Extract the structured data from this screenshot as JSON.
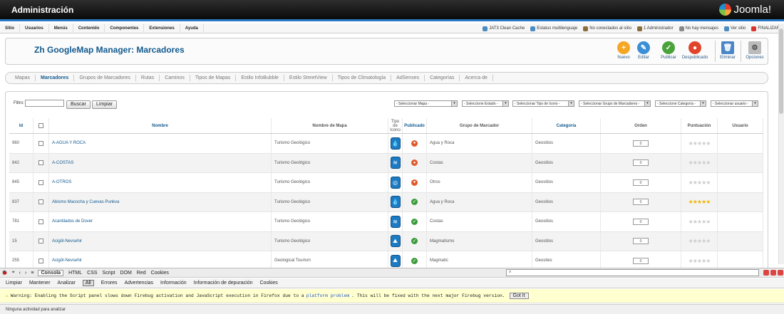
{
  "header": {
    "site_title": "Administración",
    "logo_text": "Joomla!"
  },
  "menu": [
    "Sitio",
    "Usuarios",
    "Menús",
    "Contenido",
    "Componentes",
    "Extensiones",
    "Ayuda"
  ],
  "status": [
    {
      "label": "JAT3 Clean Cache",
      "color": "#4a8bc2"
    },
    {
      "label": "Estatus multilenguaje",
      "color": "#4a8bc2"
    },
    {
      "label": "No conectados al sitio",
      "color": "#8a6d3b"
    },
    {
      "label": "1 Administrador",
      "color": "#8a6d3b"
    },
    {
      "label": "No hay mensajes",
      "color": "#888888"
    },
    {
      "label": "Ver sitio",
      "color": "#4a8bc2"
    },
    {
      "label": "FINALIZAR",
      "color": "#d9342b"
    }
  ],
  "page": {
    "title": "Zh GoogleMap Manager: Marcadores"
  },
  "toolbar": {
    "new": "Nuevo",
    "edit": "Editar",
    "publish": "Publicar",
    "unpublish": "Despublicado",
    "delete": "Eliminar",
    "options": "Opciones"
  },
  "tabs": [
    "Mapas",
    "Marcadores",
    "Grupos de Marcadores",
    "Rutas",
    "Caminos",
    "Tipos de Mapas",
    "Estilo InfoBubble",
    "Estilo StreetView",
    "Tipos de Climatología",
    "AdSenses",
    "Categorías",
    "Acerca de"
  ],
  "active_tab": "Marcadores",
  "filter": {
    "label": "Filtro:",
    "value": "",
    "search_button": "Buscar",
    "clear_button": "Limpiar"
  },
  "selects": [
    "- Seleccionar Mapa -",
    "- Seleccione Estado -",
    "- Seleccionar Tipo de Icono -",
    "- Seleccionar Grupo de Marcadores -",
    "- Seleccione Categoría -",
    "- Seleccionar usuario -"
  ],
  "columns": {
    "id": "Id",
    "name": "Nombre",
    "map_name": "Nombre de Mapa",
    "icon_type": "Tipo de Icono",
    "published": "Publicado",
    "group": "Grupo de Marcador",
    "category": "Categoría",
    "order": "Orden",
    "rating": "Puntuación",
    "user": "Usuario"
  },
  "rows": [
    {
      "id": "960",
      "name": "A-AGUA Y ROCA",
      "map": "Turismo Geológico",
      "icon": "drop",
      "published": false,
      "group": "Agua y Roca",
      "category": "Geositios",
      "order": "0",
      "rating": 0
    },
    {
      "id": "842",
      "name": "A-COSTAS",
      "map": "Turismo Geológico",
      "icon": "waves",
      "published": false,
      "group": "Costas",
      "category": "Geositios",
      "order": "0",
      "rating": 0
    },
    {
      "id": "845",
      "name": "A-OTROS",
      "map": "Turismo Geológico",
      "icon": "target",
      "published": false,
      "group": "Otros",
      "category": "Geositios",
      "order": "0",
      "rating": 0
    },
    {
      "id": "837",
      "name": "Abismo Macocha y Cuevas Punkva",
      "map": "Turismo Geológico",
      "icon": "drop",
      "published": true,
      "group": "Agua y Roca",
      "category": "Geositios",
      "order": "0",
      "rating": 5
    },
    {
      "id": "781",
      "name": "Acantilados de Dover",
      "map": "Turismo Geológico",
      "icon": "waves",
      "published": true,
      "group": "Costas",
      "category": "Geositios",
      "order": "0",
      "rating": 0
    },
    {
      "id": "15",
      "name": "Acigöl-Nevsehir",
      "map": "Turismo Geológico",
      "icon": "volcano",
      "published": true,
      "group": "Magmatismo",
      "category": "Geositios",
      "order": "0",
      "rating": 0
    },
    {
      "id": "255",
      "name": "Acigöl-Nevsehir",
      "map": "Geological Tourism",
      "icon": "volcano",
      "published": true,
      "group": "Magmatic",
      "category": "Geosites",
      "order": "0",
      "rating": 0
    }
  ],
  "firebug": {
    "tabs": [
      "Consola",
      "HTML",
      "CSS",
      "Script",
      "DOM",
      "Red",
      "Cookies"
    ],
    "subtabs": [
      "Limpiar",
      "Mantener",
      "Analizar",
      "All",
      "Errores",
      "Advertencias",
      "Información",
      "Información de depuración",
      "Cookies"
    ],
    "active_subtab": "All",
    "warning_pre": "Warning: Enabling the Script panel slows down Firebug activation and JavaScript execution in Firefox due to a",
    "warning_link": "platform problem",
    "warning_post": ". This will be fixed with the next major Firebug version.",
    "got_it": "Got It",
    "status": "Ninguna actividad para analizar"
  }
}
